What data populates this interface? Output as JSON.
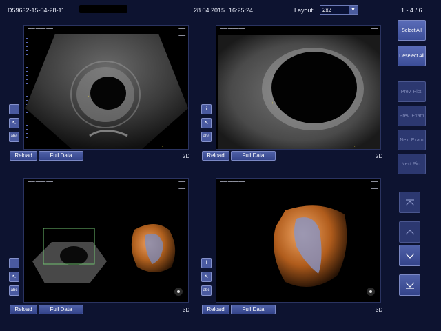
{
  "header": {
    "patient_id": "D59632-15-04-28-11",
    "date": "28.04.2015",
    "time": "16:25:24",
    "layout_label": "Layout:",
    "layout_value": "2x2",
    "page_count": "1 - 4 / 6"
  },
  "panes": [
    {
      "mode": "2D",
      "reload_label": "Reload",
      "full_data_label": "Full Data"
    },
    {
      "mode": "2D",
      "reload_label": "Reload",
      "full_data_label": "Full Data"
    },
    {
      "mode": "3D",
      "reload_label": "Reload",
      "full_data_label": "Full Data"
    },
    {
      "mode": "3D",
      "reload_label": "Reload",
      "full_data_label": "Full Data"
    }
  ],
  "side_icons": {
    "info": "i",
    "arrow": "↖",
    "text": "abc"
  },
  "right_panel": {
    "select_all": "Select All",
    "deselect_all": "Deselect All",
    "prev_pict": "Prev. Pict.",
    "prev_exam": "Prev. Exam",
    "next_exam": "Next Exam",
    "next_pict": "Next Pict."
  },
  "colors": {
    "background": "#0d1330",
    "button": "#4f61a8",
    "inactive_button": "#2c3870",
    "volume_orange": "#c9782e"
  }
}
